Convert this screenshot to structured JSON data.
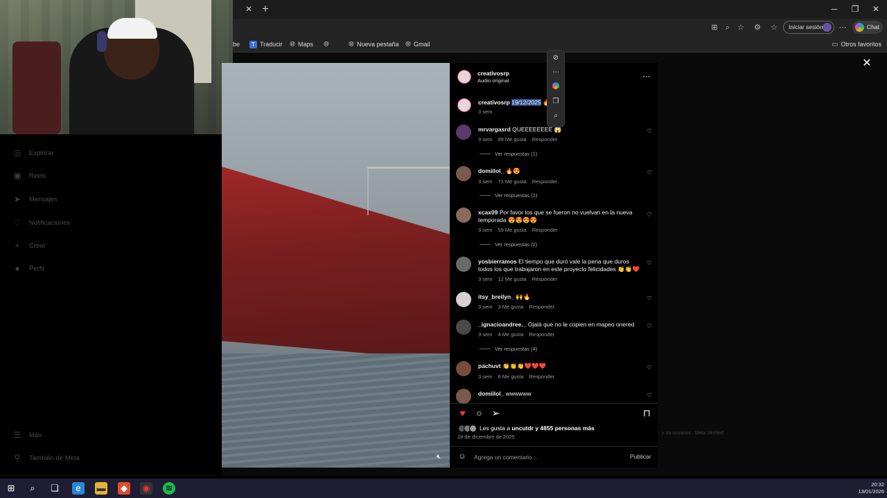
{
  "browser": {
    "tab_close": "✕",
    "tab_new": "+",
    "bookmarks": [
      {
        "label": "be",
        "icon": ""
      },
      {
        "label": "Traducir",
        "icon": "translate-icon"
      },
      {
        "label": "Maps",
        "icon": "globe-icon"
      },
      {
        "label": "",
        "icon": "globe-icon"
      },
      {
        "label": "Nueva pestaña",
        "icon": "globe-icon"
      },
      {
        "label": "Gmail",
        "icon": "globe-icon"
      }
    ],
    "other_favorites": "Otros favoritos",
    "signin": "Iniciar sesión",
    "chat": "Chat"
  },
  "sidebar": {
    "items": [
      {
        "label": "Explorar",
        "icon": "compass-icon"
      },
      {
        "label": "Reels",
        "icon": "reels-icon"
      },
      {
        "label": "Mensajes",
        "icon": "messenger-icon"
      },
      {
        "label": "Notificaciones",
        "icon": "heart-icon"
      },
      {
        "label": "Crear",
        "icon": "plus-icon"
      },
      {
        "label": "Perfil",
        "icon": "profile-icon"
      }
    ],
    "more": "Más",
    "meta": "También de Meta"
  },
  "post": {
    "username": "creativosrp",
    "audio": "Audio original",
    "caption_user": "creativosrp",
    "caption_text": "19/12/2025",
    "caption_emoji": "🔥",
    "caption_time": "3 sem"
  },
  "comments": [
    {
      "user": "mrvargasrd",
      "text": "QUEEEEEEEE 😱",
      "time": "3 sem",
      "likes": "89 Me gusta",
      "reply": "Responder",
      "replies": "Ver respuestas (1)",
      "avatar_color": "#5a3a6a"
    },
    {
      "user": "domiilol_",
      "text": "🔥😍",
      "time": "3 sem",
      "likes": "71 Me gusta",
      "reply": "Responder",
      "replies": "Ver respuestas (1)",
      "avatar_color": "#7a5a4a"
    },
    {
      "user": "xcax09",
      "text": "Por favor los que se fueron no vuelvan en la nueva temporada 😍😍😍😍",
      "time": "3 sem",
      "likes": "59 Me gusta",
      "reply": "Responder",
      "replies": "Ver respuestas (2)",
      "avatar_color": "#8a6a5a"
    },
    {
      "user": "yosbierramos",
      "text": "El tiempo que duró vale la pena que duros todos los que trabajaron en este proyecto felicidades 👏👏❤️",
      "time": "3 sem",
      "likes": "12 Me gusta",
      "reply": "Responder",
      "replies": "",
      "avatar_color": "#6a6a6a"
    },
    {
      "user": "itsy_breilyn_",
      "text": "🙌🔥",
      "time": "3 sem",
      "likes": "3 Me gusta",
      "reply": "Responder",
      "replies": "",
      "avatar_color": "#d8d0d0"
    },
    {
      "user": "_ignacioandree._",
      "text": "Ojalá que no le copien en mapeo onered",
      "time": "3 sem",
      "likes": "4 Me gusta",
      "reply": "Responder",
      "replies": "Ver respuestas (4)",
      "avatar_color": "#4a4a4a"
    },
    {
      "user": "pachuvt",
      "text": "👏👏👏❤️❤️❤️",
      "time": "3 sem",
      "likes": "8 Me gusta",
      "reply": "Responder",
      "replies": "",
      "avatar_color": "#7a4a3a"
    },
    {
      "user": "domiilol_",
      "text": "wwwwww",
      "time": "",
      "likes": "",
      "reply": "",
      "replies": "",
      "avatar_color": "#7a5a4a"
    }
  ],
  "likes": {
    "prefix": "Les gusta a",
    "user": "uncutdr",
    "rest": "y 4855 personas más"
  },
  "post_date": "18 de diciembre de 2025",
  "comment_box": {
    "placeholder": "Agrega un comentario...",
    "publish": "Publicar"
  },
  "footer": {
    "link1": "y no usuarios",
    "link2": "Meta Verified"
  },
  "taskbar": {
    "time": "20:32",
    "date": "13/01/2026"
  },
  "colors": {
    "heart_liked": "#ff3040",
    "highlight": "#2d4e8f"
  }
}
